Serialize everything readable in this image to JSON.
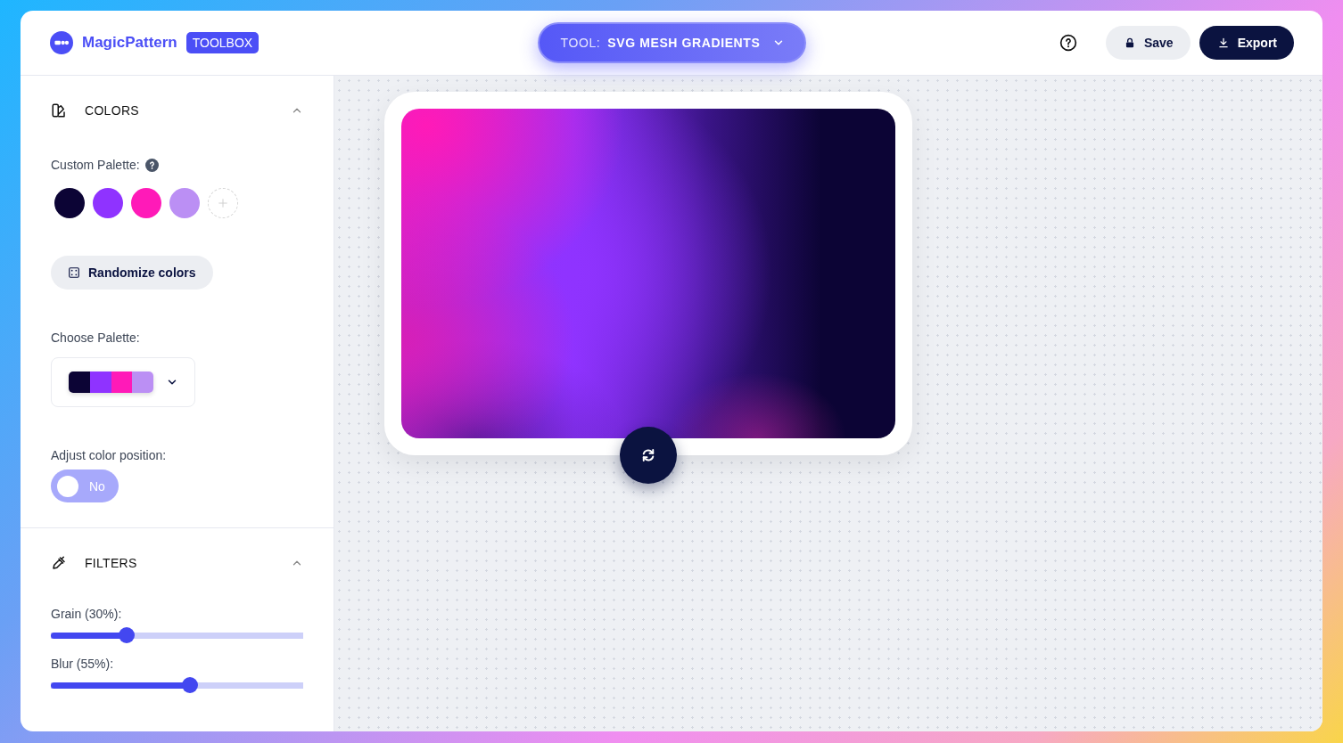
{
  "header": {
    "brand": "MagicPattern",
    "badge": "TOOLBOX",
    "tool": {
      "label": "TOOL:",
      "value": "SVG MESH GRADIENTS"
    },
    "save": "Save",
    "export": "Export"
  },
  "colors": {
    "title": "COLORS",
    "expanded": true,
    "custom_label": "Custom Palette:",
    "swatches": [
      {
        "color": "#0c0435"
      },
      {
        "color": "#8f33ff"
      },
      {
        "color": "#ff1ab8"
      },
      {
        "color": "#bb8ff4"
      }
    ],
    "randomize": "Randomize colors",
    "choose_label": "Choose Palette:",
    "palette": [
      {
        "color": "#0c0435"
      },
      {
        "color": "#8f33ff"
      },
      {
        "color": "#ff1ab8"
      },
      {
        "color": "#bb8ff4"
      }
    ],
    "adjust_label": "Adjust color position:",
    "toggle": {
      "label": "No",
      "on": false
    }
  },
  "filters": {
    "title": "FILTERS",
    "expanded": true,
    "sliders": [
      {
        "label": "Grain (30%):",
        "level": 0.3
      },
      {
        "label": "Blur (55%):",
        "level": 0.55
      }
    ]
  }
}
